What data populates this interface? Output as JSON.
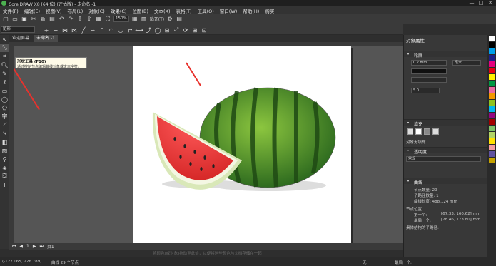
{
  "window": {
    "title": "CorelDRAW X8 (64 位) (评估版) - 未命名 -1",
    "controls": [
      "—",
      "□",
      "✕"
    ]
  },
  "menu": [
    "文件(F)",
    "编辑(E)",
    "视图(V)",
    "布局(L)",
    "对象(C)",
    "效果(C)",
    "位图(B)",
    "文本(X)",
    "表格(T)",
    "工具(O)",
    "窗口(W)",
    "帮助(H)",
    "购买"
  ],
  "toolbar": {
    "zoom": "150%",
    "snap_label": "贴齐(T)"
  },
  "propbar": {
    "shape_select": "矩形"
  },
  "tabs": [
    {
      "label": "欢迎屏幕",
      "active": false
    },
    {
      "label": "未命名 -1",
      "active": true
    }
  ],
  "tooltip": {
    "title": "形状工具 (F10)",
    "description": "通过控制节点编辑曲线对象或文本字符。"
  },
  "page_nav": {
    "page_count": "1",
    "page_label": "页1"
  },
  "canvas_hint": "将颜色(或对象)拖动至此处，以便将这些颜色与文档存储在一起",
  "statusbar": {
    "coords": "(-122.065, 226.789)",
    "object_info": "曲线 29 个节点",
    "fill_label": "无",
    "outline_label": "最后一个:"
  },
  "rpanel": {
    "title": "对象属性",
    "outline_section": "轮廓",
    "outline_width": "0.2 mm",
    "outline_units": "毫米",
    "miter_value": "5.0",
    "fill_section": "填充",
    "fill_desc": "对象无填充",
    "transparency_section": "透明度",
    "transparency_mode": "常规",
    "curve_section": "曲线",
    "node_count_label": "节点数量: 29",
    "subpath_label": "子路径数量: 1",
    "curve_length_label": "曲线长度: 488.124 mm",
    "node_pos_label": "节点位置",
    "first_label": "第一个:",
    "first_value": "[67.33, 160.62] mm",
    "last_label": "最后一个:",
    "last_value": "[78.46, 173.80] mm",
    "close_label": "具体结构的子路径:"
  },
  "palette": [
    "#ffffff",
    "#000000",
    "#00a0e9",
    "#1d2088",
    "#e4007f",
    "#e60012",
    "#fff100",
    "#009944",
    "#ea68a2",
    "#f39800",
    "#8fc31f",
    "#00b7ee",
    "#920783",
    "#a40000",
    "#7fc269",
    "#b3d465",
    "#ffe100",
    "#f29c9f",
    "#5f52a0",
    "#c6a300"
  ],
  "accent": "#e8322d"
}
